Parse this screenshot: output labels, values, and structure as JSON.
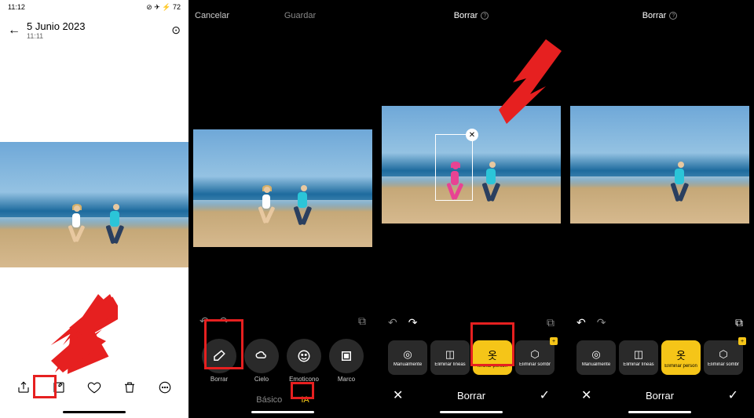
{
  "panel1": {
    "status_time": "11:12",
    "status_icons_left": "⏻ …",
    "status_icons_right": "⊘ ✈ ⚡ 72",
    "date": "5 Junio 2023",
    "time": "11:11",
    "bottom_icons": [
      "share",
      "edit",
      "favorite",
      "delete",
      "more"
    ]
  },
  "panel2": {
    "cancel": "Cancelar",
    "save": "Guardar",
    "tools": [
      {
        "label": "Borrar",
        "icon": "eraser"
      },
      {
        "label": "Cielo",
        "icon": "cloud"
      },
      {
        "label": "Emoticono",
        "icon": "smile"
      },
      {
        "label": "Marco",
        "icon": "frame"
      }
    ],
    "mode_basic": "Básico",
    "mode_ia": "IA"
  },
  "panel3": {
    "title": "Borrar",
    "tools": [
      {
        "label": "Manualmente",
        "icon": "target"
      },
      {
        "label": "Eliminar líneas",
        "icon": "lines"
      },
      {
        "label": "liminar person",
        "icon": "person",
        "active": true
      },
      {
        "label": "Eliminar sombr",
        "icon": "basket",
        "badge": true
      }
    ],
    "cancel_x": "✕",
    "confirm": "Borrar",
    "check": "✓"
  },
  "panel4": {
    "title": "Borrar",
    "tools": [
      {
        "label": "Manualmente",
        "icon": "target"
      },
      {
        "label": "Eliminar líneas",
        "icon": "lines"
      },
      {
        "label": "Eliminar person",
        "icon": "person",
        "active": true
      },
      {
        "label": "Eliminar sombr",
        "icon": "basket",
        "badge": true
      }
    ],
    "cancel_x": "✕",
    "confirm": "Borrar",
    "check": "✓"
  },
  "colors": {
    "highlight_red": "#e62020",
    "accent_yellow": "#f5c518",
    "selection_pink": "#e84393"
  }
}
